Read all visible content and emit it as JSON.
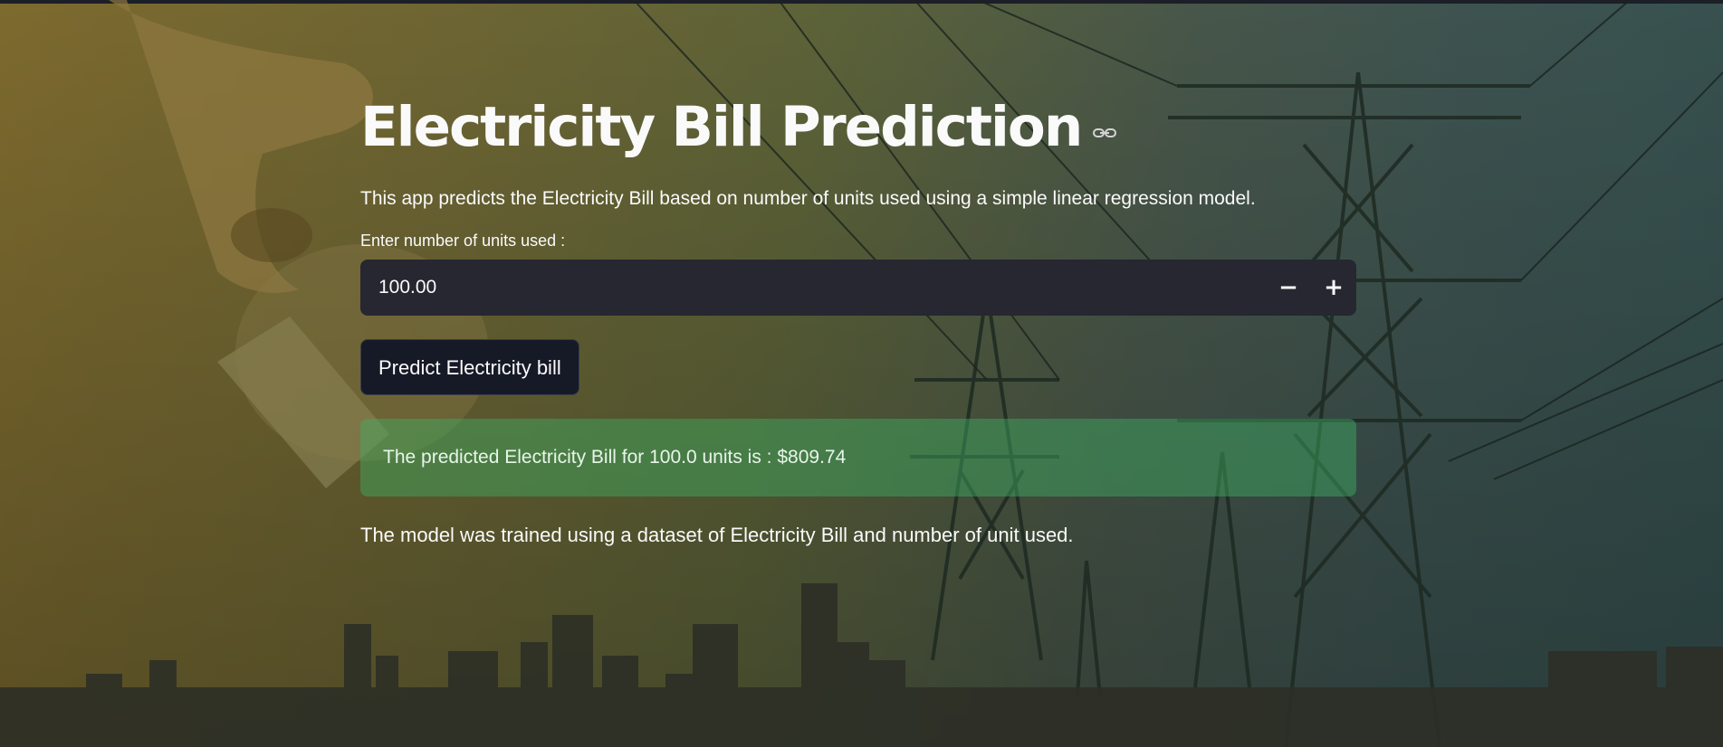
{
  "app": {
    "title": "Electricity Bill Prediction",
    "description": "This app predicts the Electricity Bill based on number of units used using a simple linear regression model."
  },
  "input": {
    "label": "Enter number of units used :",
    "value": "100.00",
    "decrement_label": "−",
    "increment_label": "+"
  },
  "predict_button": {
    "label": "Predict Electricity bill"
  },
  "result": {
    "text": "The predicted Electricity Bill for 100.0 units is : $809.74"
  },
  "footer": {
    "text": "The model was trained using a dataset of Electricity Bill and number of unit used."
  },
  "theme": {
    "input_bg": "#262730",
    "button_bg": "#161a27",
    "success_bg": "#3db064",
    "text": "#fafafa"
  },
  "icons": {
    "anchor_link": "link-icon"
  }
}
